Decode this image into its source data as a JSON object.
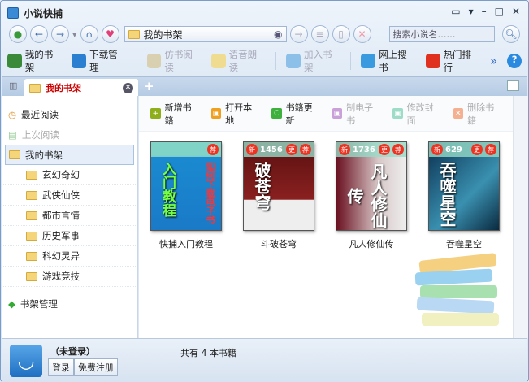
{
  "app": {
    "title": "小说快捕"
  },
  "nav": {
    "address": "我的书架",
    "search_placeholder": "搜索小说名……"
  },
  "toolbar": [
    {
      "label": "我的书架",
      "enabled": true,
      "color": "#3a8a3a"
    },
    {
      "label": "下载管理",
      "enabled": true,
      "color": "#2a7fd0"
    },
    {
      "label": "仿书阅读",
      "enabled": false,
      "color": "#d8d0b0"
    },
    {
      "label": "语音朗读",
      "enabled": false,
      "color": "#f0dc90"
    },
    {
      "label": "加入书架",
      "enabled": false,
      "color": "#8cc0e8"
    },
    {
      "label": "网上搜书",
      "enabled": true,
      "color": "#3a9ae0"
    },
    {
      "label": "热门排行",
      "enabled": true,
      "color": "#e03020"
    }
  ],
  "toolbar_more": "»",
  "tab": {
    "label": "我的书架"
  },
  "sidebar": {
    "recent": "最近阅读",
    "last": "上次阅读",
    "shelf": "我的书架",
    "categories": [
      "玄幻奇幻",
      "武侠仙侠",
      "都市言情",
      "历史军事",
      "科幻灵异",
      "游戏竞技"
    ],
    "manage": "书架管理"
  },
  "actions": [
    {
      "label": "新增书籍",
      "enabled": true,
      "color": "#8fae1b",
      "glyph": "+"
    },
    {
      "label": "打开本地",
      "enabled": true,
      "color": "#f0a020",
      "glyph": "▣"
    },
    {
      "label": "书籍更新",
      "enabled": true,
      "color": "#3db03d",
      "glyph": "C"
    },
    {
      "label": "制电子书",
      "enabled": false,
      "color": "#c9a0d8",
      "glyph": "▣"
    },
    {
      "label": "修改封面",
      "enabled": false,
      "color": "#9fdcc8",
      "glyph": "▣"
    },
    {
      "label": "删除书籍",
      "enabled": false,
      "color": "#f4b090",
      "glyph": "✕"
    }
  ],
  "books": [
    {
      "name": "快捕入门教程",
      "new_badge": "",
      "count": "",
      "update_badge": "",
      "rec_badge": "荐",
      "cover_text": "入门教程",
      "cover_text2": "如何下载电子书",
      "bg": "linear-gradient(#2ab0c0 15%,#1a8ad0 16%,#1a7ac8)"
    },
    {
      "name": "斗破苍穹",
      "new_badge": "新",
      "count": "1456",
      "update_badge": "更",
      "rec_badge": "荐",
      "cover_text": "破苍穹",
      "cover_text2": "",
      "bg": "linear-gradient(#5a1010,#8a2020 65%,#eee 66%)"
    },
    {
      "name": "凡人修仙传",
      "new_badge": "新",
      "count": "1736",
      "update_badge": "更",
      "rec_badge": "荐",
      "cover_text": "凡人修仙传",
      "cover_text2": "",
      "bg": "linear-gradient(90deg,#6a1020,#d8c8c8 60%,#eee)"
    },
    {
      "name": "吞噬星空",
      "new_badge": "新",
      "count": "629",
      "update_badge": "更",
      "rec_badge": "荐",
      "cover_text": "吞噬星空",
      "cover_text2": "",
      "bg": "linear-gradient(135deg,#0a3050,#3a90b0 60%,#0a2a40)"
    }
  ],
  "user": {
    "status": "（未登录）",
    "login": "登录",
    "register": "免费注册"
  },
  "statusbar": "共有 4 本书籍"
}
